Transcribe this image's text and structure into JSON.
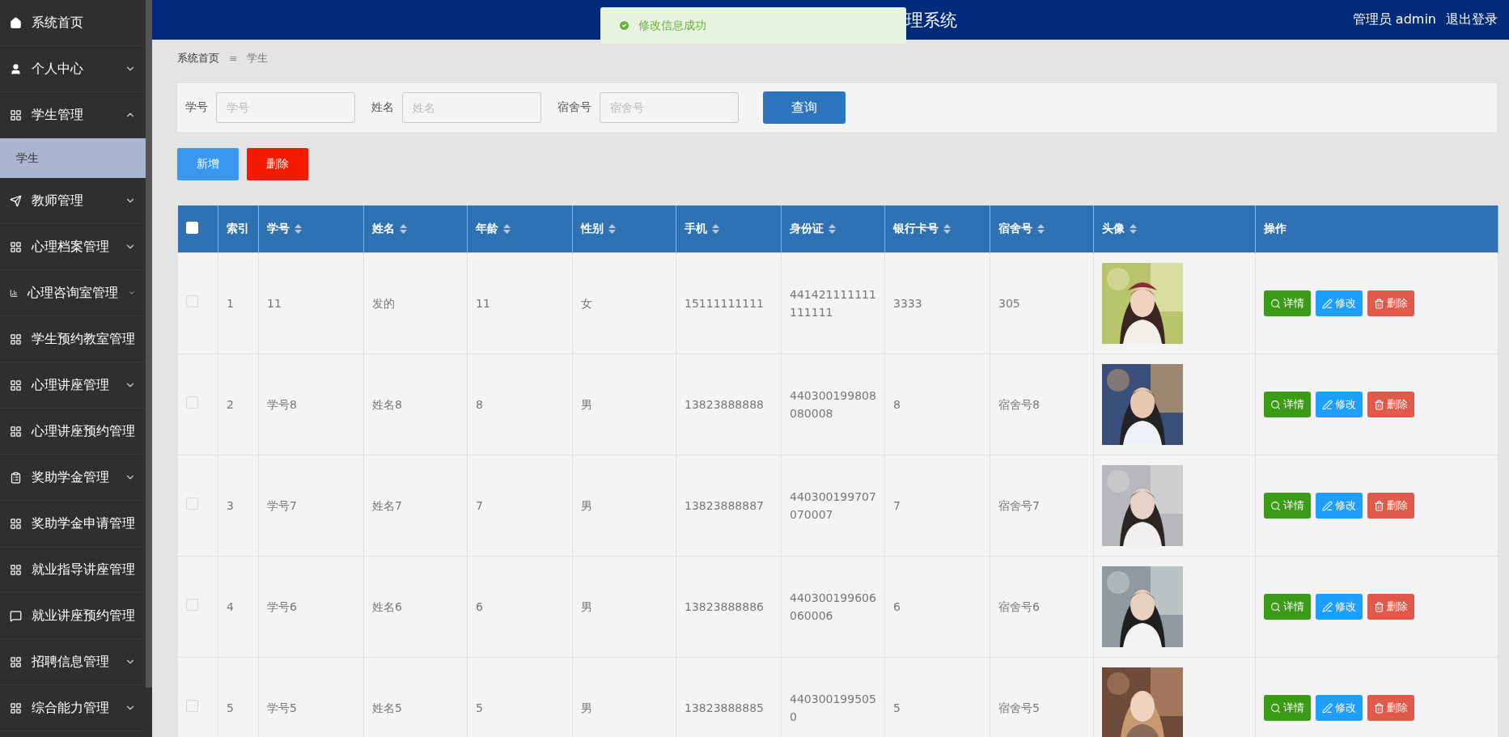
{
  "sidebar": {
    "items": [
      {
        "label": "系统首页",
        "kind": "home",
        "selected": false
      },
      {
        "label": "个人中心",
        "kind": "user",
        "expanded": false,
        "selected": false
      },
      {
        "label": "学生管理",
        "kind": "grid",
        "expanded": true,
        "selected": false,
        "children": [
          {
            "label": "学生",
            "selected": true
          }
        ]
      },
      {
        "label": "教师管理",
        "kind": "send",
        "expanded": false,
        "selected": false
      },
      {
        "label": "心理档案管理",
        "kind": "grid",
        "expanded": false,
        "selected": false
      },
      {
        "label": "心理咨询室管理",
        "kind": "chart",
        "expanded": false,
        "selected": false
      },
      {
        "label": "学生预约教室管理",
        "kind": "grid",
        "selected": false
      },
      {
        "label": "心理讲座管理",
        "kind": "grid",
        "expanded": false,
        "selected": false
      },
      {
        "label": "心理讲座预约管理",
        "kind": "grid",
        "selected": false
      },
      {
        "label": "奖助学金管理",
        "kind": "clipboard",
        "expanded": false,
        "selected": false
      },
      {
        "label": "奖助学金申请管理",
        "kind": "grid",
        "selected": false
      },
      {
        "label": "就业指导讲座管理",
        "kind": "grid",
        "selected": false
      },
      {
        "label": "就业讲座预约管理",
        "kind": "chat",
        "selected": false
      },
      {
        "label": "招聘信息管理",
        "kind": "grid",
        "expanded": false,
        "selected": false
      },
      {
        "label": "综合能力管理",
        "kind": "grid",
        "expanded": false,
        "selected": false
      }
    ]
  },
  "header": {
    "title": "理系统",
    "user": "管理员 admin",
    "logout": "退出登录"
  },
  "toast": {
    "message": "修改信息成功"
  },
  "breadcrumb": {
    "items": [
      "系统首页",
      "学生"
    ],
    "separator": "≡"
  },
  "search": {
    "fields": [
      {
        "label": "学号",
        "placeholder": "学号"
      },
      {
        "label": "姓名",
        "placeholder": "姓名"
      },
      {
        "label": "宿舍号",
        "placeholder": "宿舍号"
      }
    ],
    "button": "查询"
  },
  "actions": {
    "add": "新增",
    "delete": "删除"
  },
  "table": {
    "header_checked": false,
    "columns": [
      {
        "label": "索引",
        "sortable": false
      },
      {
        "label": "学号",
        "sortable": true
      },
      {
        "label": "姓名",
        "sortable": true
      },
      {
        "label": "年龄",
        "sortable": true
      },
      {
        "label": "性别",
        "sortable": true
      },
      {
        "label": "手机",
        "sortable": true
      },
      {
        "label": "身份证",
        "sortable": true
      },
      {
        "label": "银行卡号",
        "sortable": true
      },
      {
        "label": "宿舍号",
        "sortable": true
      },
      {
        "label": "头像",
        "sortable": true
      },
      {
        "label": "操作",
        "sortable": false
      }
    ],
    "rows": [
      {
        "checked": false,
        "cells": [
          "1",
          "11",
          "发的",
          "11",
          "女",
          "15111111111",
          "441421111111111111",
          "3333",
          "305"
        ],
        "buttons": [
          {
            "kind": "detail",
            "label": "详情"
          },
          {
            "kind": "edit",
            "label": "修改"
          },
          {
            "kind": "delete",
            "label": "删除"
          }
        ]
      },
      {
        "checked": false,
        "cells": [
          "2",
          "学号8",
          "姓名8",
          "8",
          "男",
          "13823888888",
          "440300199808080008",
          "8",
          "宿舍号8"
        ],
        "buttons": [
          {
            "kind": "detail",
            "label": "详情"
          },
          {
            "kind": "edit",
            "label": "修改"
          },
          {
            "kind": "delete",
            "label": "删除"
          }
        ]
      },
      {
        "checked": false,
        "cells": [
          "3",
          "学号7",
          "姓名7",
          "7",
          "男",
          "13823888887",
          "440300199707070007",
          "7",
          "宿舍号7"
        ],
        "buttons": [
          {
            "kind": "detail",
            "label": "详情"
          },
          {
            "kind": "edit",
            "label": "修改"
          },
          {
            "kind": "delete",
            "label": "删除"
          }
        ]
      },
      {
        "checked": false,
        "cells": [
          "4",
          "学号6",
          "姓名6",
          "6",
          "男",
          "13823888886",
          "440300199606060006",
          "6",
          "宿舍号6"
        ],
        "buttons": [
          {
            "kind": "detail",
            "label": "详情"
          },
          {
            "kind": "edit",
            "label": "修改"
          },
          {
            "kind": "delete",
            "label": "删除"
          }
        ]
      },
      {
        "checked": false,
        "cells": [
          "5",
          "学号5",
          "姓名5",
          "5",
          "男",
          "13823888885",
          "4403001995050",
          "5",
          "宿舍号5"
        ],
        "buttons": [
          {
            "kind": "detail",
            "label": "详情"
          },
          {
            "kind": "edit",
            "label": "修改"
          },
          {
            "kind": "delete",
            "label": "删除"
          }
        ]
      }
    ]
  }
}
